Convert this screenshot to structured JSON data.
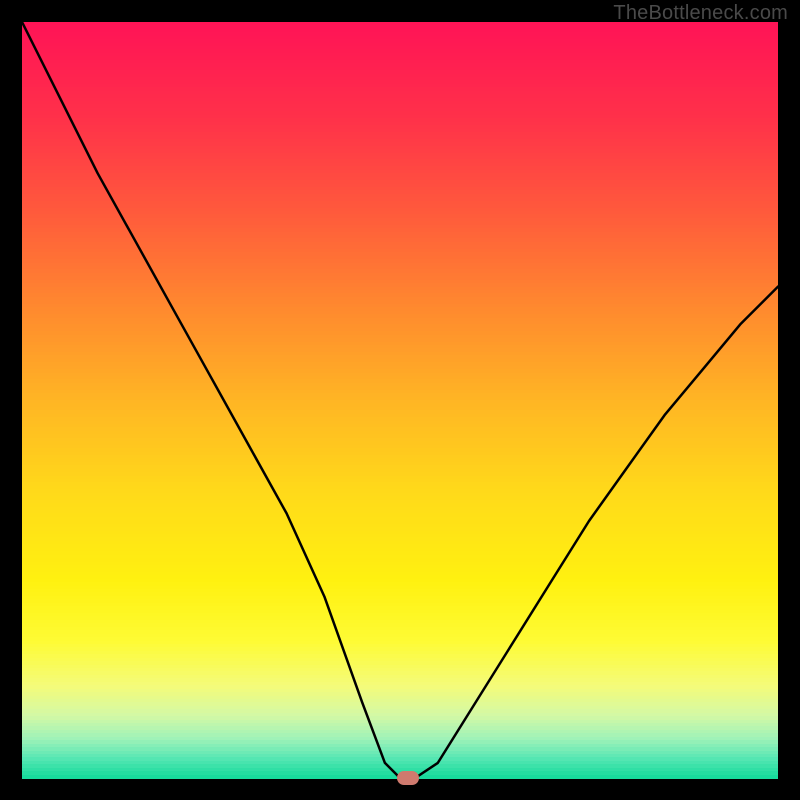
{
  "watermark": "TheBottleneck.com",
  "chart_data": {
    "type": "line",
    "title": "",
    "xlabel": "",
    "ylabel": "",
    "xlim": [
      0,
      100
    ],
    "ylim": [
      0,
      100
    ],
    "x": [
      0,
      5,
      10,
      15,
      20,
      25,
      30,
      35,
      40,
      45,
      48,
      50,
      52,
      55,
      60,
      65,
      70,
      75,
      80,
      85,
      90,
      95,
      100
    ],
    "values": [
      100,
      90,
      80,
      71,
      62,
      53,
      44,
      35,
      24,
      10,
      2,
      0,
      0,
      2,
      10,
      18,
      26,
      34,
      41,
      48,
      54,
      60,
      65
    ],
    "marker": {
      "x": 51,
      "y": 0
    },
    "gradient_stops": [
      {
        "pos": 0.0,
        "color": "#ff1456"
      },
      {
        "pos": 0.12,
        "color": "#ff2f4a"
      },
      {
        "pos": 0.25,
        "color": "#ff5a3c"
      },
      {
        "pos": 0.38,
        "color": "#ff8a2e"
      },
      {
        "pos": 0.5,
        "color": "#ffb524"
      },
      {
        "pos": 0.62,
        "color": "#ffd91a"
      },
      {
        "pos": 0.74,
        "color": "#fff110"
      },
      {
        "pos": 0.82,
        "color": "#fefb34"
      },
      {
        "pos": 0.88,
        "color": "#f4fb7a"
      },
      {
        "pos": 0.92,
        "color": "#d2f9a6"
      },
      {
        "pos": 0.95,
        "color": "#9ff2b8"
      },
      {
        "pos": 0.975,
        "color": "#5ae7b4"
      },
      {
        "pos": 1.0,
        "color": "#18db9c"
      }
    ]
  }
}
